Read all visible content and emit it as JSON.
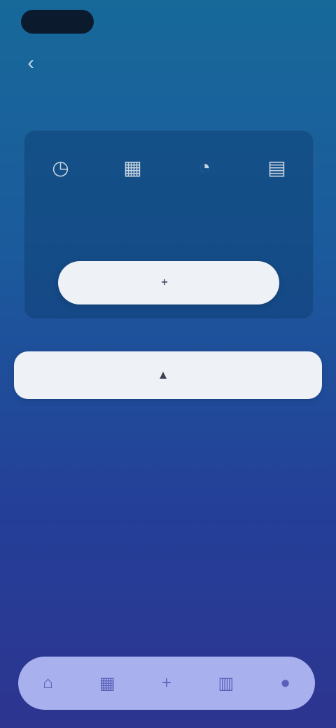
{
  "header": {
    "back_glyph": "‹",
    "title": ""
  },
  "card": {
    "icons": [
      {
        "name": "clock-icon",
        "glyph": "◷"
      },
      {
        "name": "calendar-icon",
        "glyph": "▦"
      },
      {
        "name": "bell-icon",
        "glyph": "◔"
      },
      {
        "name": "chart-icon",
        "glyph": "▤"
      }
    ],
    "text": "",
    "button_icon": "+",
    "button_label": ""
  },
  "wide_button": {
    "icon": "▲",
    "label": ""
  },
  "bottom_nav": {
    "items": [
      {
        "name": "nav-home",
        "glyph": "⌂"
      },
      {
        "name": "nav-calendar",
        "glyph": "▦"
      },
      {
        "name": "nav-add",
        "glyph": "+"
      },
      {
        "name": "nav-stats",
        "glyph": "▥"
      },
      {
        "name": "nav-profile",
        "glyph": "●"
      }
    ]
  },
  "colors": {
    "bg_top": "#17699a",
    "bg_bottom": "#2d3590",
    "button_bg": "#eef1f6",
    "nav_bg": "#a9b0ee"
  }
}
